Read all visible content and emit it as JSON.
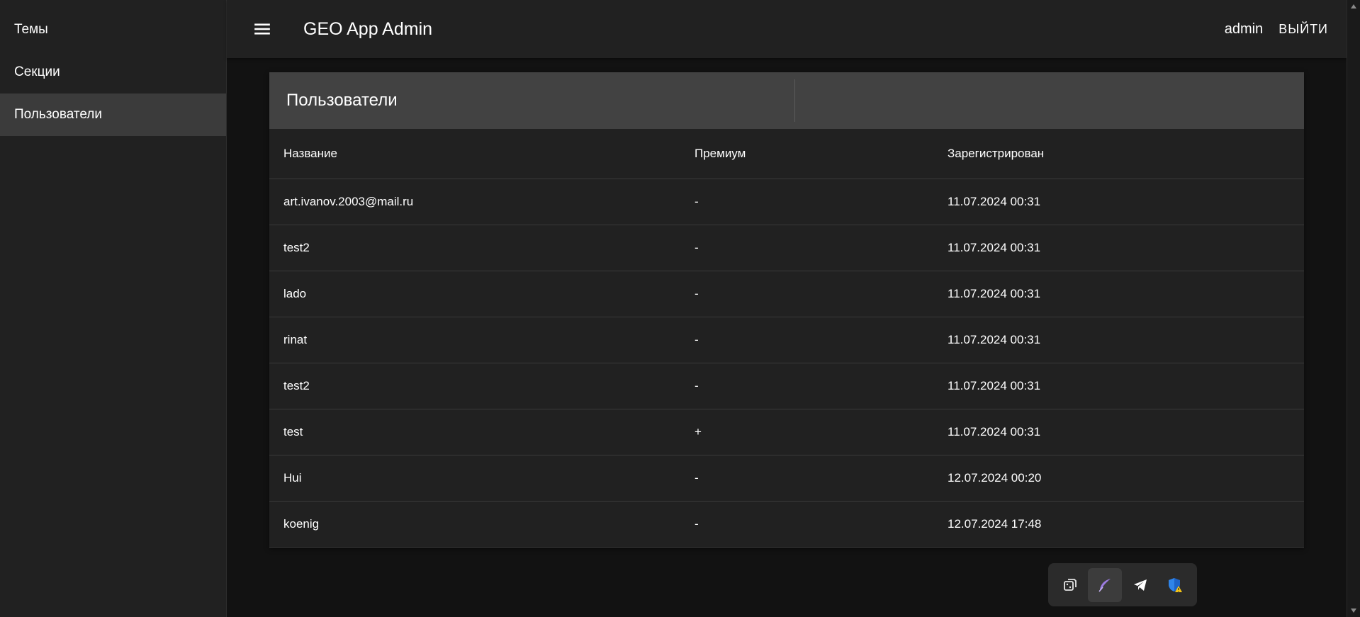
{
  "sidebar": {
    "items": [
      {
        "label": "Темы"
      },
      {
        "label": "Секции"
      },
      {
        "label": "Пользователи"
      }
    ]
  },
  "appbar": {
    "title": "GEO App Admin",
    "username": "admin",
    "logout_label": "ВЫЙТИ"
  },
  "card": {
    "title": "Пользователи",
    "columns": [
      "Название",
      "Премиум",
      "Зарегистрирован"
    ],
    "rows": [
      {
        "name": "art.ivanov.2003@mail.ru",
        "premium": "-",
        "registered": "11.07.2024 00:31"
      },
      {
        "name": "test2",
        "premium": "-",
        "registered": "11.07.2024 00:31"
      },
      {
        "name": "lado",
        "premium": "-",
        "registered": "11.07.2024 00:31"
      },
      {
        "name": "rinat",
        "premium": "-",
        "registered": "11.07.2024 00:31"
      },
      {
        "name": "test2",
        "premium": "-",
        "registered": "11.07.2024 00:31"
      },
      {
        "name": "test",
        "premium": "+",
        "registered": "11.07.2024 00:31"
      },
      {
        "name": "Hui",
        "premium": "-",
        "registered": "12.07.2024 00:20"
      },
      {
        "name": "koenig",
        "premium": "-",
        "registered": "12.07.2024 17:48"
      }
    ]
  },
  "extension_toolbar": {
    "icons": [
      "dice-icon",
      "feather-icon",
      "paper-plane-icon",
      "shield-warning-icon"
    ]
  },
  "colors": {
    "background": "#121212",
    "surface": "#212121",
    "card_header": "#424242",
    "sidebar_active": "#3b3b3b",
    "text": "#ffffff"
  }
}
